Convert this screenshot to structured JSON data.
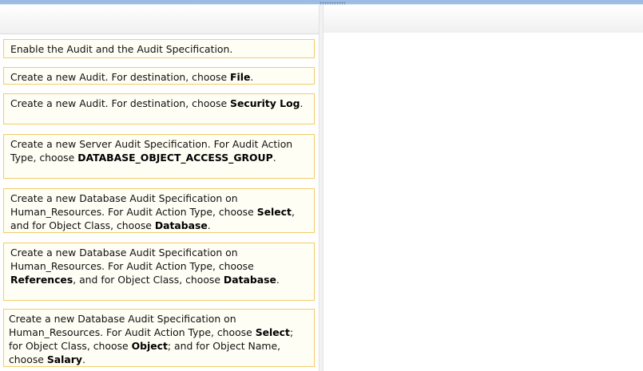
{
  "items": [
    {
      "segments": [
        {
          "t": "Enable the Audit and the Audit Specification.",
          "b": false
        }
      ]
    },
    {
      "segments": [
        {
          "t": "Create a new Audit. For destination, choose ",
          "b": false
        },
        {
          "t": "File",
          "b": true
        },
        {
          "t": ".",
          "b": false
        }
      ]
    },
    {
      "segments": [
        {
          "t": "Create a new Audit. For destination, choose ",
          "b": false
        },
        {
          "t": "Security Log",
          "b": true
        },
        {
          "t": ".",
          "b": false
        }
      ]
    },
    {
      "segments": [
        {
          "t": "Create a new Server Audit Specification. For Audit Action Type, choose ",
          "b": false
        },
        {
          "t": "DATABASE_OBJECT_ACCESS_GROUP",
          "b": true
        },
        {
          "t": ".",
          "b": false
        }
      ]
    },
    {
      "segments": [
        {
          "t": "Create a new Database Audit Specification on Human_Resources. For Audit Action Type, choose ",
          "b": false
        },
        {
          "t": "Select",
          "b": true
        },
        {
          "t": ", and for Object Class, choose ",
          "b": false
        },
        {
          "t": "Database",
          "b": true
        },
        {
          "t": ".",
          "b": false
        }
      ]
    },
    {
      "segments": [
        {
          "t": "Create a new Database Audit Specification on Human_Resources. For Audit Action Type, choose ",
          "b": false
        },
        {
          "t": "References",
          "b": true
        },
        {
          "t": ", and for Object Class, choose ",
          "b": false
        },
        {
          "t": "Database",
          "b": true
        },
        {
          "t": ".",
          "b": false
        }
      ]
    },
    {
      "segments": [
        {
          "t": "Create a new Database Audit Specification on Human_Resources. For Audit Action Type, choose ",
          "b": false
        },
        {
          "t": "Select",
          "b": true
        },
        {
          "t": "; for Object Class, choose ",
          "b": false
        },
        {
          "t": "Object",
          "b": true
        },
        {
          "t": "; and for Object Name, choose ",
          "b": false
        },
        {
          "t": "Salary",
          "b": true
        },
        {
          "t": ".",
          "b": false
        }
      ]
    }
  ]
}
